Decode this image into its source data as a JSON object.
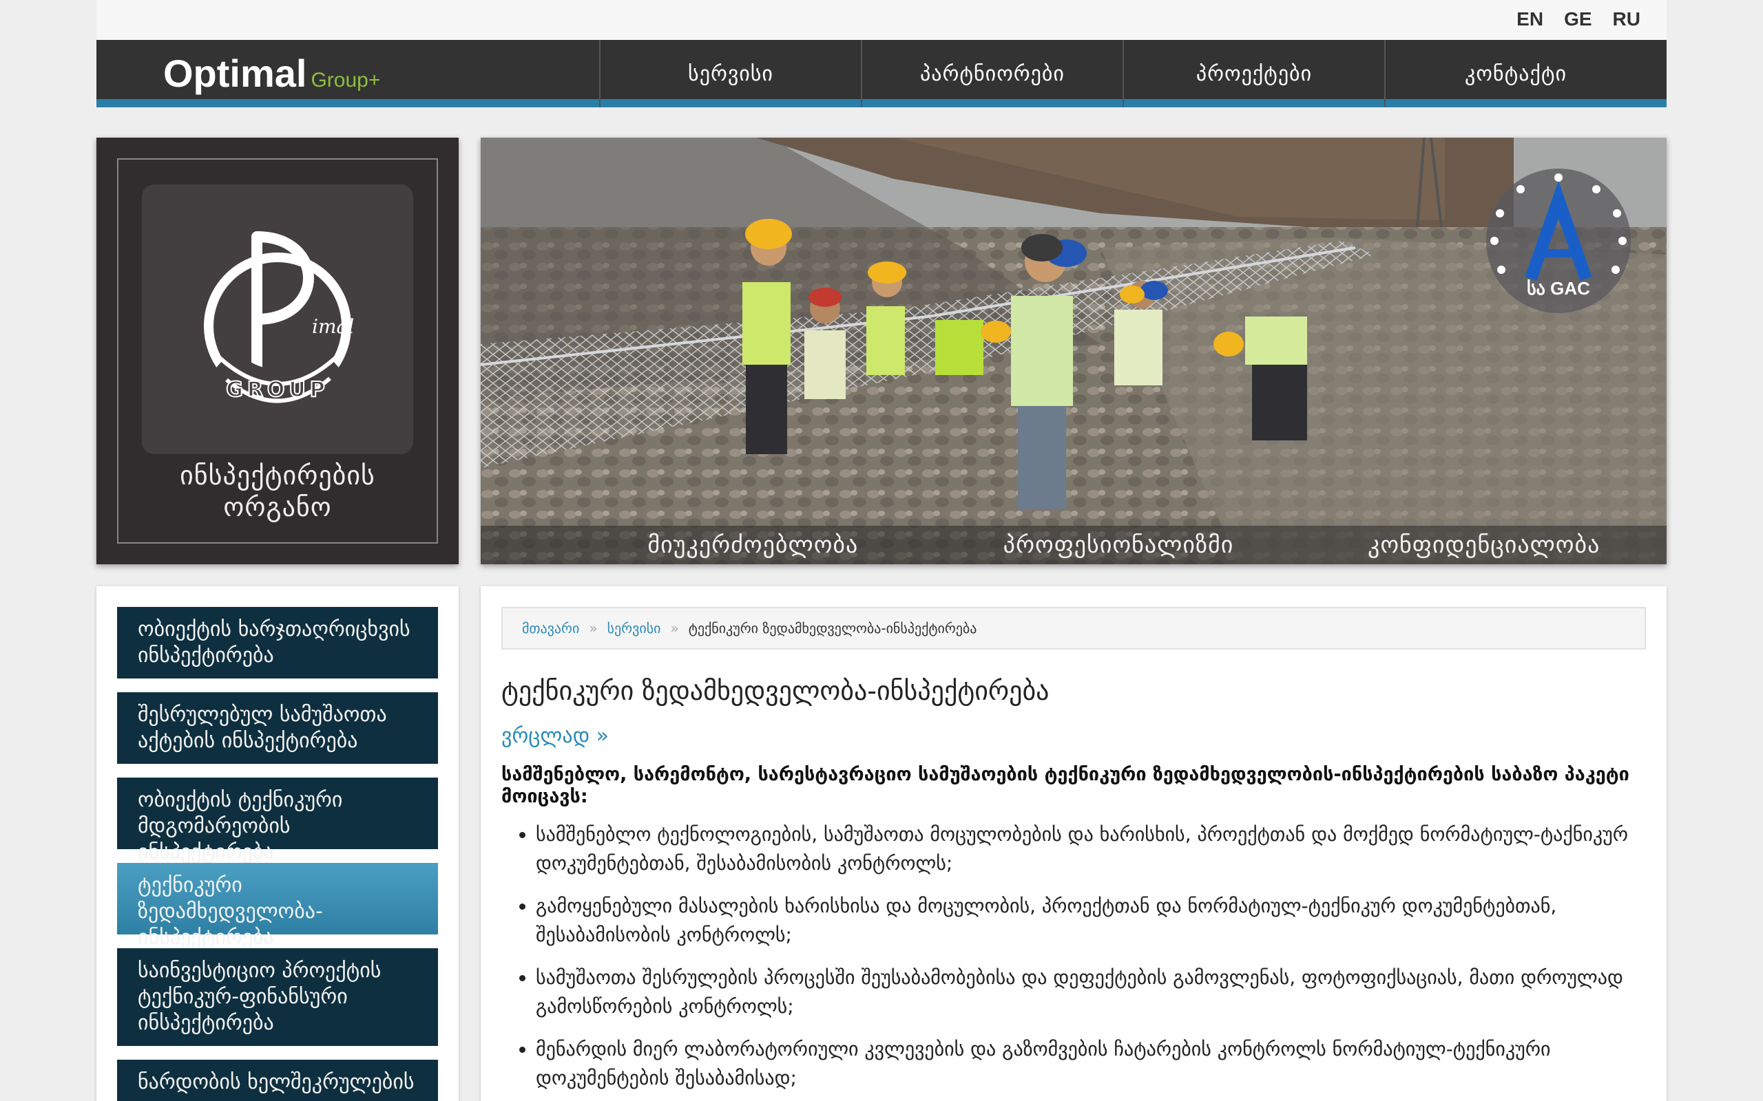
{
  "languages": [
    "EN",
    "GE",
    "RU"
  ],
  "brand": {
    "main": "Optimal",
    "sub": "Group+"
  },
  "nav": [
    "სერვისი",
    "პარტნიორები",
    "პროექტები",
    "კონტაქტი"
  ],
  "logo_card": {
    "caption_line1": "ინსპექტირების",
    "caption_line2": "ორგანო"
  },
  "hero": {
    "badge_text": "სა GAC",
    "captions": [
      "მიუკერძოებლობა",
      "პროფესიონალიზმი",
      "კონფიდენციალობა"
    ]
  },
  "sidebar": [
    "ობიექტის ხარჯთაღრიცხვის ინსპექტირება",
    "შესრულებულ სამუშაოთა აქტების ინსპექტირება",
    "ობიექტის ტექნიკური მდგომარეობის ინსპექტირება",
    "ტექნიკური ზედამხედველობა-ინსპექტირება",
    "საინვესტიციო პროექტის ტექნიკურ-ფინანსური ინსპექტირება",
    "ნარდობის ხელშეკრულების"
  ],
  "breadcrumb": {
    "home": "მთავარი",
    "section": "სერვისი",
    "current": "ტექნიკური ზედამხედველობა-ინსპექტირება",
    "separator": "»"
  },
  "main": {
    "title": "ტექნიკური ზედამხედველობა-ინსპექტირება",
    "more": "ვრცლად »",
    "lead": "სამშენებლო, სარემონტო, სარესტავრაციო სამუშაოების ტექნიკური ზედამხედველობის-ინსპექტირების საბაზო პაკეტი მოიცავს:",
    "bullets": [
      "სამშენებლო ტექნოლოგიების, სამუშაოთა მოცულობების და ხარისხის, პროექტთან და მოქმედ ნორმატიულ-ტაქნიკურ დოკუმენტებთან, შესაბამისობის კონტროლს;",
      "გამოყენებული მასალების ხარისხისა და მოცულობის, პროექტთან და ნორმატიულ-ტექნიკურ დოკუმენტებთან, შესაბამისობის კონტროლს;",
      "სამუშაოთა შესრულების პროცესში შეუსაბამობებისა და დეფექტების გამოვლენას, ფოტოფიქსაციას, მათი დროულად გამოსწორების კონტროლს;",
      "მენარდის მიერ ლაბორატორიული კვლევების და გაზომვების ჩატარების კონტროლს ნორმატიულ-ტექნიკური დოკუმენტების შესაბამისად;"
    ]
  },
  "colors": {
    "nav_bg": "#333333",
    "accent_blue": "#2a7ea8",
    "brand_green": "#8dbf3f",
    "side_bg": "#0e2f40",
    "side_active": "#3b91b8",
    "link": "#2a8ab8"
  }
}
